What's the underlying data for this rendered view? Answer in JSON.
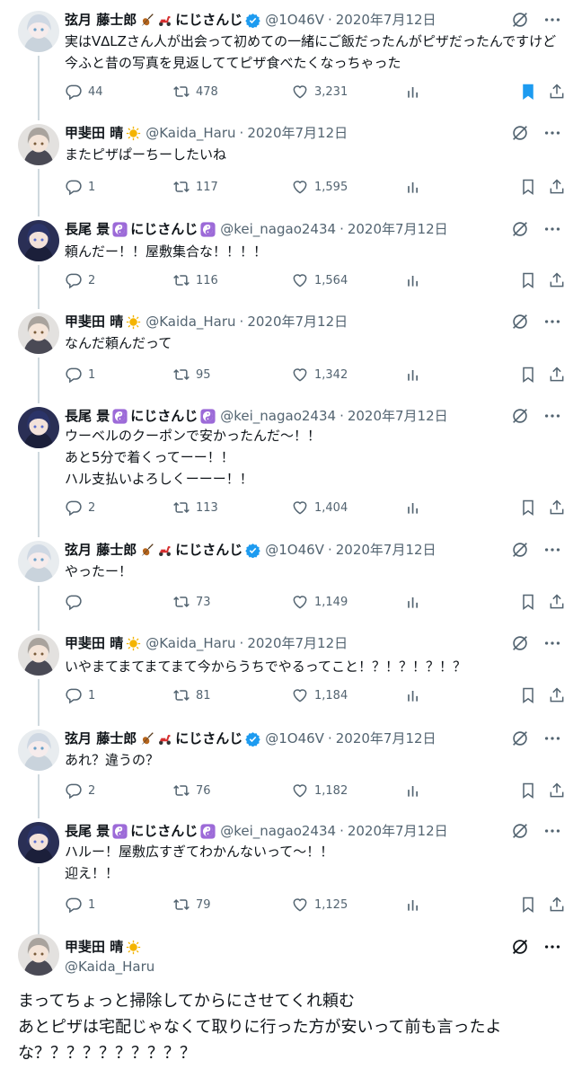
{
  "tweets": [
    {
      "avatar": "genzuki",
      "name": "弦月 藤士郎",
      "emojis": [
        "violin",
        "scooter"
      ],
      "affiliation": "にじさんじ",
      "verified": true,
      "affiliation_badge": "",
      "handle": "@1O46V",
      "date": "2020年7月12日",
      "text": "実はV∆LZさん人が出会って初めての一緒にご飯だったんがピザだったんですけど今ふと昔の写真を見返しててピザ食べたくなっちゃった",
      "replies": "44",
      "retweets": "478",
      "likes": "3,231",
      "bookmarked": true
    },
    {
      "avatar": "kaida",
      "name": "甲斐田 晴",
      "emojis": [
        "sun"
      ],
      "affiliation": "",
      "verified": false,
      "handle": "@Kaida_Haru",
      "date": "2020年7月12日",
      "text": "またピザぱーちーしたいね",
      "replies": "1",
      "retweets": "117",
      "likes": "1,595",
      "bookmarked": false
    },
    {
      "avatar": "nagao",
      "name": "長尾 景",
      "emojis": [
        "yinyang"
      ],
      "affiliation": "にじさんじ",
      "verified": false,
      "affiliation_badge": "yinyang",
      "handle": "@kei_nagao2434",
      "date": "2020年7月12日",
      "text": "頼んだー！！屋敷集合な！！！！",
      "replies": "2",
      "retweets": "116",
      "likes": "1,564",
      "bookmarked": false
    },
    {
      "avatar": "kaida",
      "name": "甲斐田 晴",
      "emojis": [
        "sun"
      ],
      "affiliation": "",
      "verified": false,
      "handle": "@Kaida_Haru",
      "date": "2020年7月12日",
      "text": "なんだ頼んだって",
      "replies": "1",
      "retweets": "95",
      "likes": "1,342",
      "bookmarked": false
    },
    {
      "avatar": "nagao",
      "name": "長尾 景",
      "emojis": [
        "yinyang"
      ],
      "affiliation": "にじさんじ",
      "verified": false,
      "affiliation_badge": "yinyang",
      "handle": "@kei_nagao2434",
      "date": "2020年7月12日",
      "text": "ウーベルのクーポンで安かったんだ〜！！\nあと5分で着くってーー！！\nハル支払いよろしくーーー！！",
      "replies": "2",
      "retweets": "113",
      "likes": "1,404",
      "bookmarked": false
    },
    {
      "avatar": "genzuki",
      "name": "弦月 藤士郎",
      "emojis": [
        "violin",
        "scooter"
      ],
      "affiliation": "にじさんじ",
      "verified": true,
      "handle": "@1O46V",
      "date": "2020年7月12日",
      "text": "やったー！",
      "replies": "",
      "retweets": "73",
      "likes": "1,149",
      "bookmarked": false
    },
    {
      "avatar": "kaida",
      "name": "甲斐田 晴",
      "emojis": [
        "sun"
      ],
      "affiliation": "",
      "verified": false,
      "handle": "@Kaida_Haru",
      "date": "2020年7月12日",
      "text": "いやまてまてまてまて今からうちでやるってこと！？！？！？！？",
      "replies": "1",
      "retweets": "81",
      "likes": "1,184",
      "bookmarked": false
    },
    {
      "avatar": "genzuki",
      "name": "弦月 藤士郎",
      "emojis": [
        "violin",
        "scooter"
      ],
      "affiliation": "にじさんじ",
      "verified": true,
      "handle": "@1O46V",
      "date": "2020年7月12日",
      "text": "あれ？違うの？",
      "replies": "2",
      "retweets": "76",
      "likes": "1,182",
      "bookmarked": false
    },
    {
      "avatar": "nagao",
      "name": "長尾 景",
      "emojis": [
        "yinyang"
      ],
      "affiliation": "にじさんじ",
      "verified": false,
      "affiliation_badge": "yinyang",
      "handle": "@kei_nagao2434",
      "date": "2020年7月12日",
      "text": "ハルー！屋敷広すぎてわかんないって〜！！\n迎え！！",
      "replies": "1",
      "retweets": "79",
      "likes": "1,125",
      "bookmarked": false
    }
  ],
  "main_tweet": {
    "avatar": "kaida",
    "name": "甲斐田 晴",
    "emojis": [
      "sun"
    ],
    "handle": "@Kaida_Haru",
    "text": "まってちょっと掃除してからにさせてくれ頼む\nあとピザは宅配じゃなくて取りに行った方が安いって前も言ったよな？？？？？？？？？？"
  },
  "colors": {
    "accent": "#1d9bf0",
    "muted": "#536471",
    "line": "#cfd9de",
    "sun": "#f4b400",
    "yinyang": "#9c6ad8"
  }
}
